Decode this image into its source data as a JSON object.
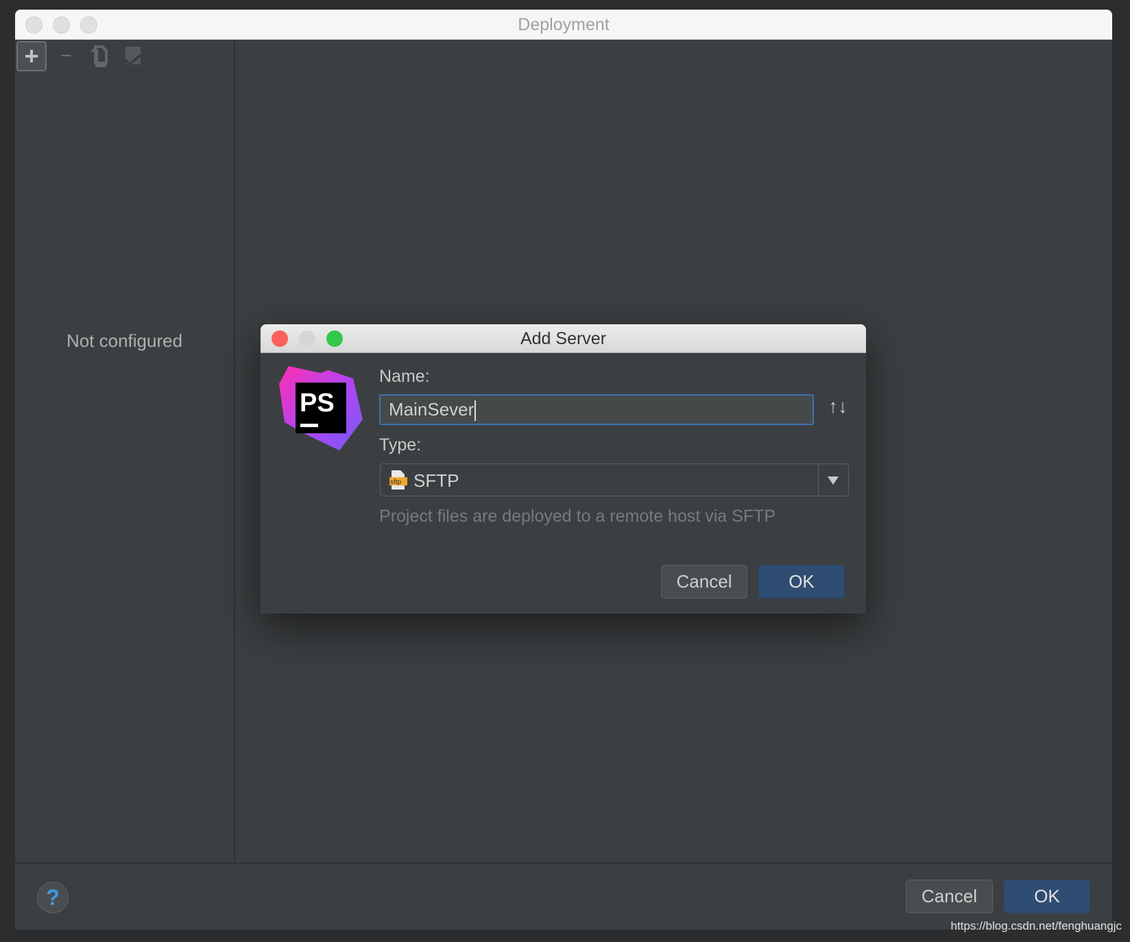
{
  "window": {
    "title": "Deployment"
  },
  "toolbar": {
    "add": "+",
    "remove": "−",
    "copy_icon": "copy-icon",
    "check_icon": "check-list-icon"
  },
  "sidebar": {
    "empty_text": "Not configured"
  },
  "footer": {
    "help": "?",
    "cancel": "Cancel",
    "ok": "OK"
  },
  "dialog": {
    "title": "Add Server",
    "logo": "PS",
    "name_label": "Name:",
    "name_value": "MainSever",
    "sort_icon": "↑↓",
    "type_label": "Type:",
    "type_value": "SFTP",
    "type_icon_text": "sftp",
    "description": "Project files are deployed to a remote host via SFTP",
    "cancel": "Cancel",
    "ok": "OK"
  },
  "watermark": "https://blog.csdn.net/fenghuangjc",
  "colors": {
    "accent": "#3d73b3",
    "ok_button": "#2f4d72",
    "close": "#fc605c",
    "zoom": "#34c84a"
  }
}
